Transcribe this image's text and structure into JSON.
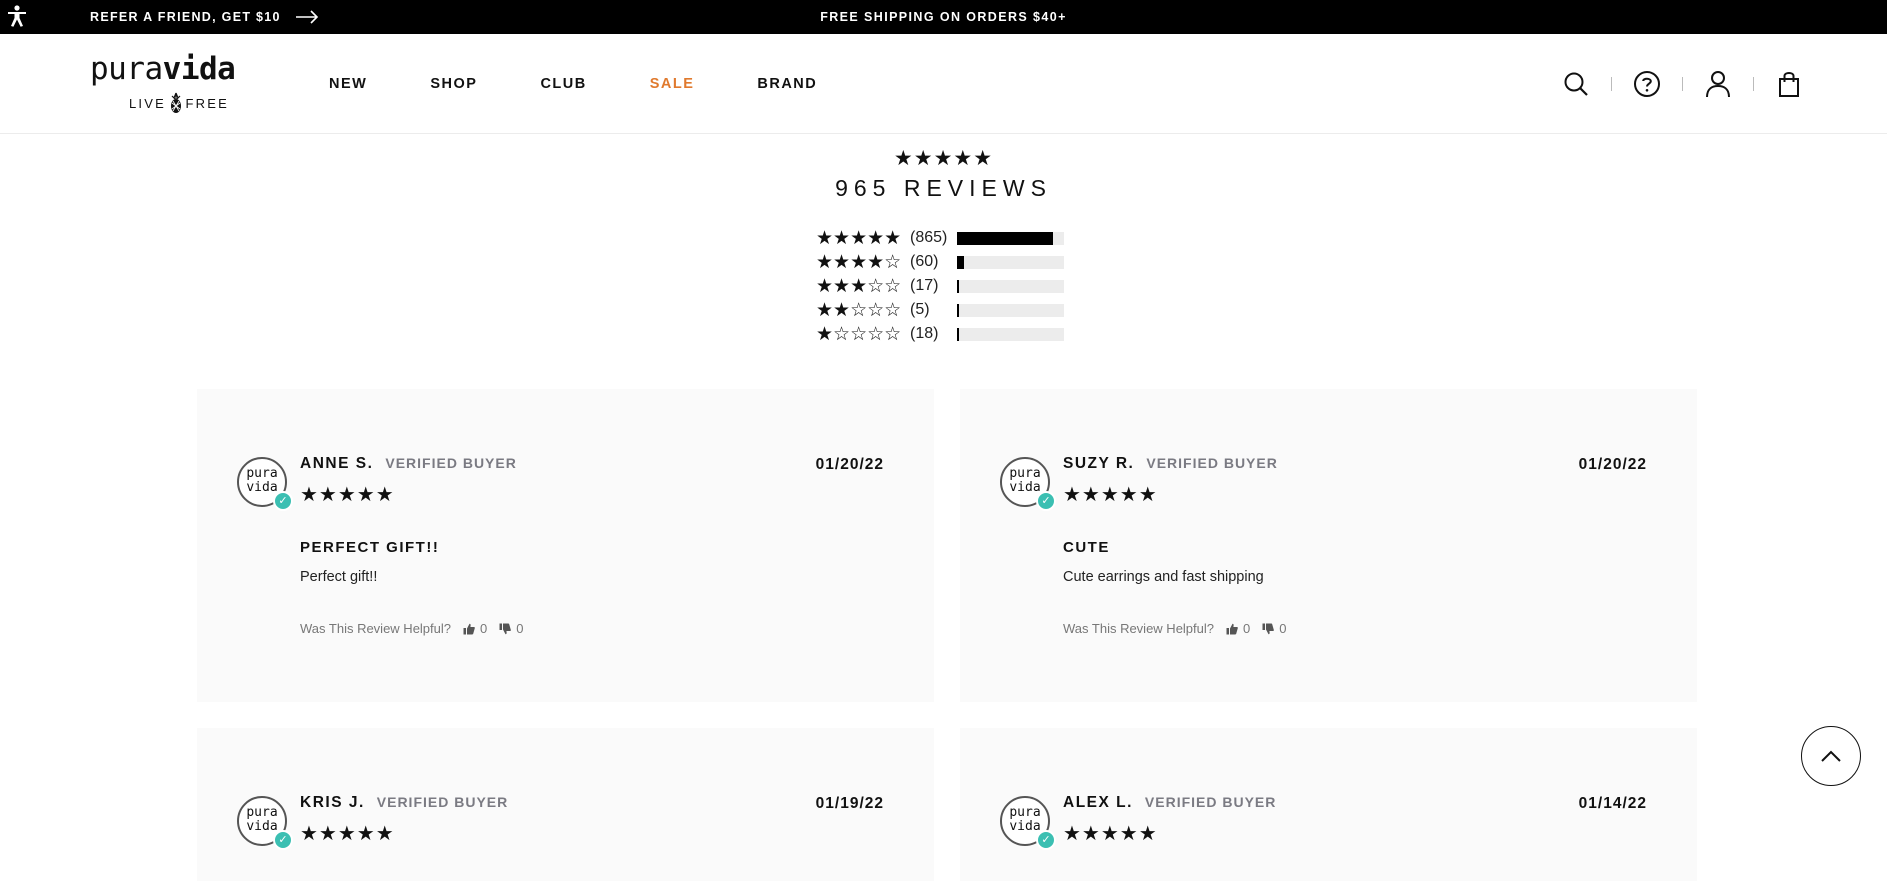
{
  "topbar": {
    "refer_text": "REFER A FRIEND, GET $10",
    "shipping_text": "FREE SHIPPING ON ORDERS $40+"
  },
  "header": {
    "logo": {
      "word_light": "pura",
      "word_bold": "vida",
      "tag_left": "LIVE",
      "tag_right": "FREE"
    },
    "nav": [
      {
        "label": "NEW"
      },
      {
        "label": "SHOP"
      },
      {
        "label": "CLUB"
      },
      {
        "label": "SALE",
        "color": "#e07a2e"
      },
      {
        "label": "BRAND"
      }
    ],
    "icons": [
      "search-icon",
      "help-icon",
      "account-icon",
      "cart-icon"
    ]
  },
  "summary": {
    "average_stars": "★★★★★",
    "title": "965 REVIEWS",
    "distribution": [
      {
        "stars": "★★★★★",
        "count": "(865)",
        "fraction": 0.896
      },
      {
        "stars": "★★★★☆",
        "count": "(60)",
        "fraction": 0.062
      },
      {
        "stars": "★★★☆☆",
        "count": "(17)",
        "fraction": 0.018
      },
      {
        "stars": "★★☆☆☆",
        "count": "(5)",
        "fraction": 0.005
      },
      {
        "stars": "★☆☆☆☆",
        "count": "(18)",
        "fraction": 0.019
      }
    ]
  },
  "reviews": [
    {
      "author": "ANNE S.",
      "badge": "VERIFIED BUYER",
      "date": "01/20/22",
      "stars": "★★★★★",
      "title": "PERFECT GIFT!!",
      "body": "Perfect gift!!",
      "helpful_label": "Was This Review Helpful?",
      "up": "0",
      "down": "0",
      "avatar_top": "pura",
      "avatar_bottom": "vida"
    },
    {
      "author": "SUZY R.",
      "badge": "VERIFIED BUYER",
      "date": "01/20/22",
      "stars": "★★★★★",
      "title": "CUTE",
      "body": "Cute earrings and fast shipping",
      "helpful_label": "Was This Review Helpful?",
      "up": "0",
      "down": "0",
      "avatar_top": "pura",
      "avatar_bottom": "vida"
    },
    {
      "author": "KRIS J.",
      "badge": "VERIFIED BUYER",
      "date": "01/19/22",
      "stars": "★★★★★",
      "avatar_top": "pura",
      "avatar_bottom": "vida"
    },
    {
      "author": "ALEX L.",
      "badge": "VERIFIED BUYER",
      "date": "01/14/22",
      "stars": "★★★★★",
      "avatar_top": "pura",
      "avatar_bottom": "vida"
    }
  ],
  "colors": {
    "accent_sale": "#e07a2e",
    "verified_check": "#3bbfb2",
    "card_bg": "#fafafa"
  }
}
